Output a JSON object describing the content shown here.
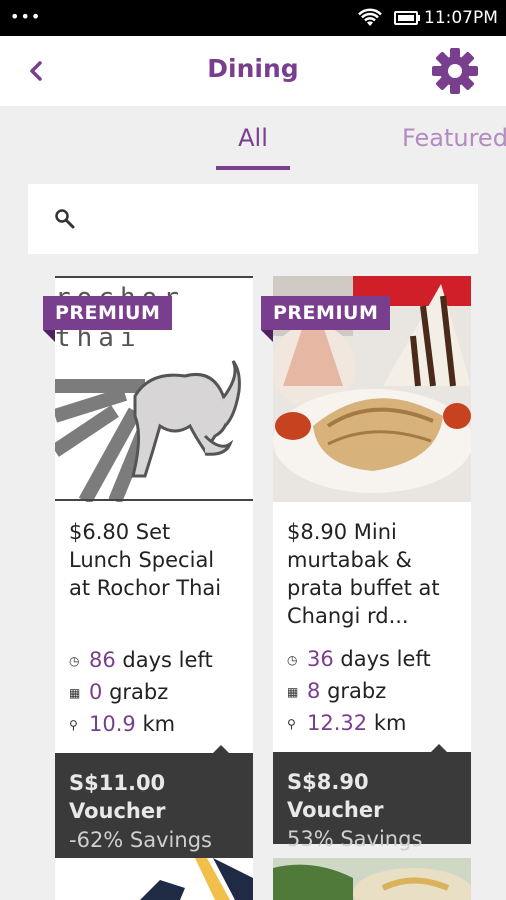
{
  "status": {
    "time": "11:07PM",
    "menu_dots": "•••"
  },
  "header": {
    "title": "Dining"
  },
  "tabs": [
    {
      "label": "All",
      "active": true
    },
    {
      "label": "Featured",
      "active": false
    }
  ],
  "search": {
    "placeholder": ""
  },
  "colors": {
    "accent": "#7a3e8e",
    "voucher_bg": "#3a3a3a"
  },
  "cards": [
    {
      "badge": "PREMIUM",
      "logo_text_line1": "rochor",
      "logo_text_line2": "thai",
      "title": "$6.80 Set Lunch Special at Rochor Thai",
      "days_num": "86",
      "days_label": "days left",
      "grabz_num": "0",
      "grabz_label": "grabz",
      "distance_num": "10.9",
      "distance_unit": "km",
      "voucher_title": "S$11.00 Voucher",
      "voucher_sub": "-62% Savings"
    },
    {
      "badge": "PREMIUM",
      "title": "$8.90 Mini murtabak & prata buffet at Changi rd...",
      "days_num": "36",
      "days_label": "days left",
      "grabz_num": "8",
      "grabz_label": "grabz",
      "distance_num": "12.32",
      "distance_unit": "km",
      "voucher_title": "S$8.90 Voucher",
      "voucher_sub": "53% Savings"
    }
  ]
}
